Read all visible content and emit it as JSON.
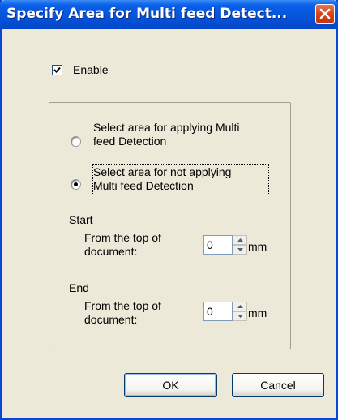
{
  "window": {
    "title": "Specify Area for Multi feed Detect..."
  },
  "enable": {
    "label": "Enable",
    "checked": true
  },
  "area_options": [
    {
      "label_line1": "Select area for applying Multi",
      "label_line2": "feed Detection",
      "selected": false
    },
    {
      "label_line1": "Select area for not applying",
      "label_line2": "Multi feed Detection",
      "selected": true
    }
  ],
  "start": {
    "heading": "Start",
    "field_label_line1": "From the top of",
    "field_label_line2": "document:",
    "value": "0",
    "unit": "mm"
  },
  "end": {
    "heading": "End",
    "field_label_line1": "From the top of",
    "field_label_line2": "document:",
    "value": "0",
    "unit": "mm"
  },
  "buttons": {
    "ok": "OK",
    "cancel": "Cancel"
  },
  "icons": [
    "close-icon",
    "checkmark-icon",
    "spin-up-arrow-icon",
    "spin-down-arrow-icon"
  ]
}
